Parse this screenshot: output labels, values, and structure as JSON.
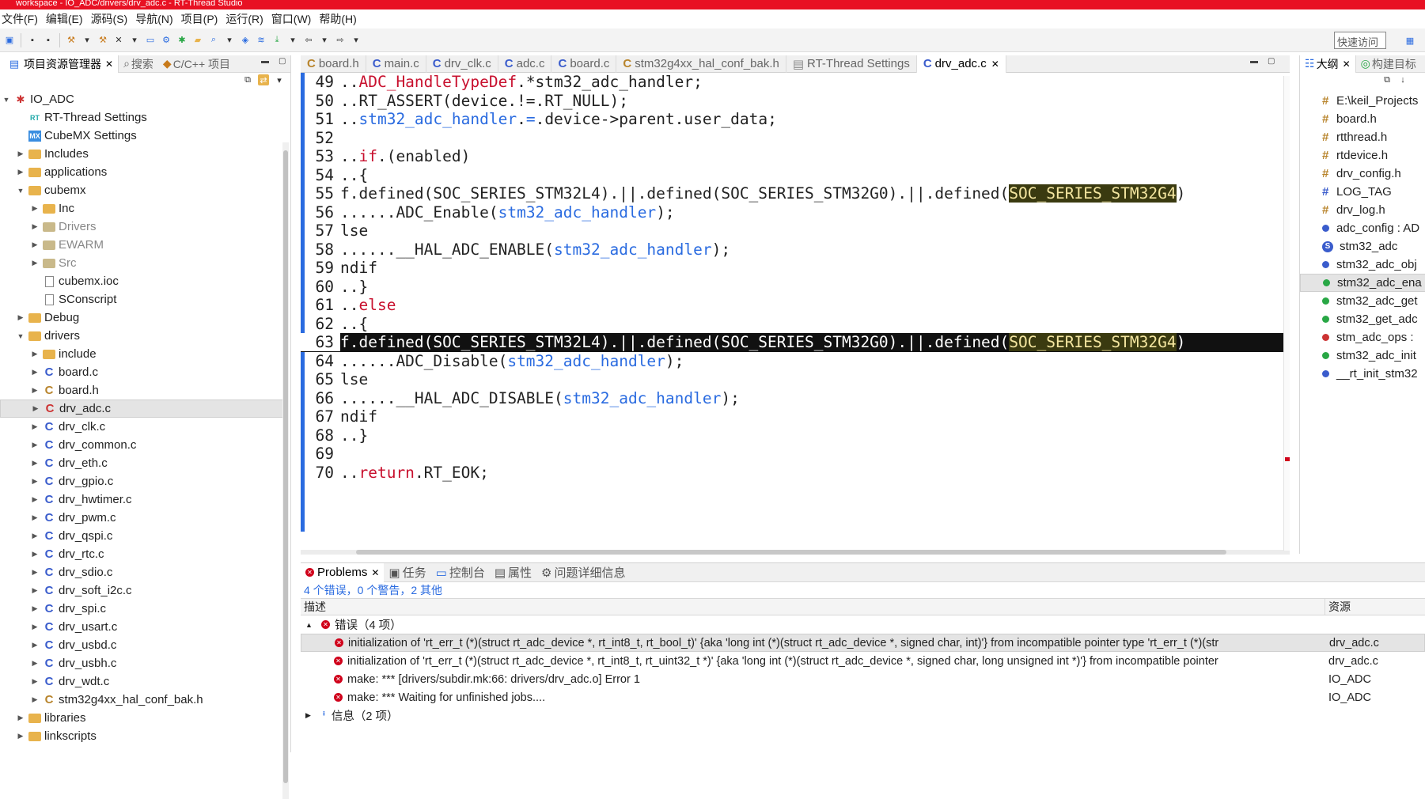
{
  "window": {
    "title": "workspace - IO_ADC/drivers/drv_adc.c - RT-Thread Studio"
  },
  "menu": [
    "文件(F)",
    "编辑(E)",
    "源码(S)",
    "导航(N)",
    "项目(P)",
    "运行(R)",
    "窗口(W)",
    "帮助(H)"
  ],
  "toolbar": {
    "quick_access": "快速访问"
  },
  "left_tabs": {
    "explorer": "项目资源管理器",
    "search": "搜索",
    "cpp": "C/C++ 项目"
  },
  "tree": [
    {
      "label": "IO_ADC",
      "icon": "project-icon",
      "arrow": "▼"
    },
    {
      "label": "RT-Thread Settings",
      "icon": "rt-settings-icon",
      "arrow": ""
    },
    {
      "label": "CubeMX Settings",
      "icon": "cubemx-icon",
      "arrow": ""
    },
    {
      "label": "Includes",
      "icon": "folder-icon",
      "arrow": "▶"
    },
    {
      "label": "applications",
      "icon": "folder-icon",
      "arrow": "▶"
    },
    {
      "label": "cubemx",
      "icon": "folder-icon",
      "arrow": "▼"
    },
    {
      "label": "Inc",
      "icon": "folder-icon",
      "arrow": "▶"
    },
    {
      "label": "Drivers",
      "icon": "folder-excluded-icon",
      "arrow": "▶"
    },
    {
      "label": "EWARM",
      "icon": "folder-excluded-icon",
      "arrow": "▶"
    },
    {
      "label": "Src",
      "icon": "folder-excluded-icon",
      "arrow": "▶"
    },
    {
      "label": "cubemx.ioc",
      "icon": "file-icon",
      "arrow": ""
    },
    {
      "label": "SConscript",
      "icon": "file-icon",
      "arrow": ""
    },
    {
      "label": "Debug",
      "icon": "folder-icon",
      "arrow": "▶"
    },
    {
      "label": "drivers",
      "icon": "folder-error-icon",
      "arrow": "▼"
    },
    {
      "label": "include",
      "icon": "folder-icon",
      "arrow": "▶"
    },
    {
      "label": "board.c",
      "icon": "c-file-icon",
      "arrow": "▶"
    },
    {
      "label": "board.h",
      "icon": "h-file-icon",
      "arrow": "▶"
    },
    {
      "label": "drv_adc.c",
      "icon": "c-file-error-icon",
      "arrow": "▶"
    },
    {
      "label": "drv_clk.c",
      "icon": "c-file-icon",
      "arrow": "▶"
    },
    {
      "label": "drv_common.c",
      "icon": "c-file-icon",
      "arrow": "▶"
    },
    {
      "label": "drv_eth.c",
      "icon": "c-file-icon",
      "arrow": "▶"
    },
    {
      "label": "drv_gpio.c",
      "icon": "c-file-icon",
      "arrow": "▶"
    },
    {
      "label": "drv_hwtimer.c",
      "icon": "c-file-icon",
      "arrow": "▶"
    },
    {
      "label": "drv_pwm.c",
      "icon": "c-file-icon",
      "arrow": "▶"
    },
    {
      "label": "drv_qspi.c",
      "icon": "c-file-icon",
      "arrow": "▶"
    },
    {
      "label": "drv_rtc.c",
      "icon": "c-file-icon",
      "arrow": "▶"
    },
    {
      "label": "drv_sdio.c",
      "icon": "c-file-icon",
      "arrow": "▶"
    },
    {
      "label": "drv_soft_i2c.c",
      "icon": "c-file-icon",
      "arrow": "▶"
    },
    {
      "label": "drv_spi.c",
      "icon": "c-file-icon",
      "arrow": "▶"
    },
    {
      "label": "drv_usart.c",
      "icon": "c-file-icon",
      "arrow": "▶"
    },
    {
      "label": "drv_usbd.c",
      "icon": "c-file-icon",
      "arrow": "▶"
    },
    {
      "label": "drv_usbh.c",
      "icon": "c-file-icon",
      "arrow": "▶"
    },
    {
      "label": "drv_wdt.c",
      "icon": "c-file-icon",
      "arrow": "▶"
    },
    {
      "label": "stm32g4xx_hal_conf_bak.h",
      "icon": "h-file-icon",
      "arrow": "▶"
    },
    {
      "label": "libraries",
      "icon": "folder-icon",
      "arrow": "▶"
    },
    {
      "label": "linkscripts",
      "icon": "folder-icon",
      "arrow": "▶"
    }
  ],
  "editor_tabs": [
    "board.h",
    "main.c",
    "drv_clk.c",
    "adc.c",
    "board.c",
    "stm32g4xx_hal_conf_bak.h",
    "RT-Thread Settings",
    "drv_adc.c"
  ],
  "code": [
    {
      "n": "49",
      "t": "..ADC_HandleTypeDef.*stm32_adc_handler;"
    },
    {
      "n": "50",
      "t": "..RT_ASSERT(device.!=.RT_NULL);"
    },
    {
      "n": "51",
      "t": "..stm32_adc_handler.=.device->parent.user_data;"
    },
    {
      "n": "52",
      "t": ""
    },
    {
      "n": "53",
      "t": "..if.(enabled)"
    },
    {
      "n": "54",
      "t": "..{"
    },
    {
      "n": "55",
      "t": "f.defined(SOC_SERIES_STM32L4).||.defined(SOC_SERIES_STM32G0).||.defined(SOC_SERIES_STM32G4)"
    },
    {
      "n": "56",
      "t": "......ADC_Enable(stm32_adc_handler);"
    },
    {
      "n": "57",
      "t": "lse"
    },
    {
      "n": "58",
      "t": "......__HAL_ADC_ENABLE(stm32_adc_handler);"
    },
    {
      "n": "59",
      "t": "ndif"
    },
    {
      "n": "60",
      "t": "..}"
    },
    {
      "n": "61",
      "t": "..else"
    },
    {
      "n": "62",
      "t": "..{"
    },
    {
      "n": "63",
      "t": "f.defined(SOC_SERIES_STM32L4).||.defined(SOC_SERIES_STM32G0).||.defined(SOC_SERIES_STM32G4)"
    },
    {
      "n": "64",
      "t": "......ADC_Disable(stm32_adc_handler);"
    },
    {
      "n": "65",
      "t": "lse"
    },
    {
      "n": "66",
      "t": "......__HAL_ADC_DISABLE(stm32_adc_handler);"
    },
    {
      "n": "67",
      "t": "ndif"
    },
    {
      "n": "68",
      "t": "..}"
    },
    {
      "n": "69",
      "t": ""
    },
    {
      "n": "70",
      "t": "..return.RT_EOK;"
    }
  ],
  "right_tabs": {
    "outline": "大纲",
    "build": "构建目标"
  },
  "outline": [
    {
      "label": "E:\\keil_Projects",
      "icon": "include-icon"
    },
    {
      "label": "board.h",
      "icon": "include-icon"
    },
    {
      "label": "rtthread.h",
      "icon": "include-icon"
    },
    {
      "label": "rtdevice.h",
      "icon": "include-icon"
    },
    {
      "label": "drv_config.h",
      "icon": "include-icon"
    },
    {
      "label": "LOG_TAG",
      "icon": "macro-icon"
    },
    {
      "label": "drv_log.h",
      "icon": "include-icon"
    },
    {
      "label": "adc_config : AD",
      "icon": "variable-icon"
    },
    {
      "label": "stm32_adc",
      "icon": "struct-icon"
    },
    {
      "label": "stm32_adc_obj",
      "icon": "variable-icon"
    },
    {
      "label": "stm32_adc_ena",
      "icon": "function-icon"
    },
    {
      "label": "stm32_adc_get",
      "icon": "function-icon"
    },
    {
      "label": "stm32_get_adc",
      "icon": "function-icon"
    },
    {
      "label": "stm_adc_ops :",
      "icon": "const-variable-icon"
    },
    {
      "label": "stm32_adc_init",
      "icon": "function-icon"
    },
    {
      "label": "__rt_init_stm32",
      "icon": "variable-icon"
    }
  ],
  "problems": {
    "tabs": [
      "Problems",
      "任务",
      "控制台",
      "属性",
      "问题详细信息"
    ],
    "summary": "4 个错误，0 个警告，2 其他",
    "col_desc": "描述",
    "col_res": "资源",
    "errors_group": "错误（4 项）",
    "info_group": "信息（2 项）",
    "rows": [
      {
        "desc": "initialization of 'rt_err_t (*)(struct rt_adc_device *, rt_int8_t,  rt_bool_t)' {aka 'long int (*)(struct rt_adc_device *, signed char,  int)'} from incompatible pointer type 'rt_err_t (*)(str",
        "res": "drv_adc.c"
      },
      {
        "desc": "initialization of 'rt_err_t (*)(struct rt_adc_device *, rt_int8_t,  rt_uint32_t *)' {aka 'long int (*)(struct rt_adc_device *, signed char,  long unsigned int *)'} from incompatible pointer",
        "res": "drv_adc.c"
      },
      {
        "desc": "make: *** [drivers/subdir.mk:66: drivers/drv_adc.o] Error 1",
        "res": "IO_ADC"
      },
      {
        "desc": "make: *** Waiting for unfinished jobs....",
        "res": "IO_ADC"
      }
    ]
  }
}
